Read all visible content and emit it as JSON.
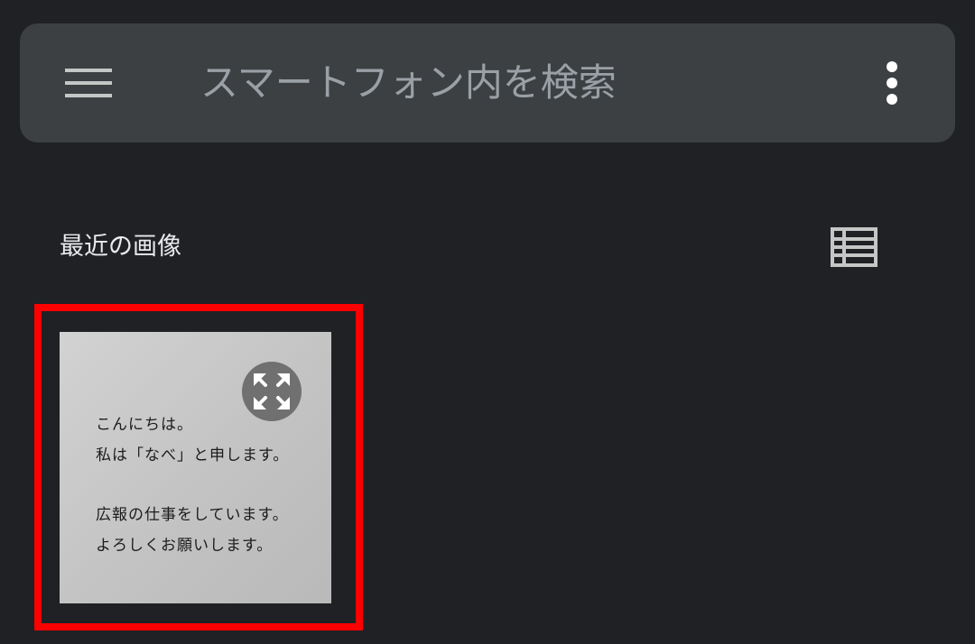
{
  "search_bar": {
    "placeholder": "スマートフォン内を検索",
    "menu_icon": "hamburger-menu-icon",
    "overflow_icon": "more-vertical-icon"
  },
  "recent": {
    "title": "最近の画像",
    "view_toggle_icon": "list-view-icon"
  },
  "image": {
    "lines_top": [
      "こんにちは。",
      "私は「なべ」と申します。"
    ],
    "lines_bottom": [
      "広報の仕事をしています。",
      "よろしくお願いします。"
    ],
    "expand_icon": "expand-icon"
  },
  "colors": {
    "background": "#202124",
    "search_bar": "#3c4043",
    "highlight": "#ff0000"
  }
}
